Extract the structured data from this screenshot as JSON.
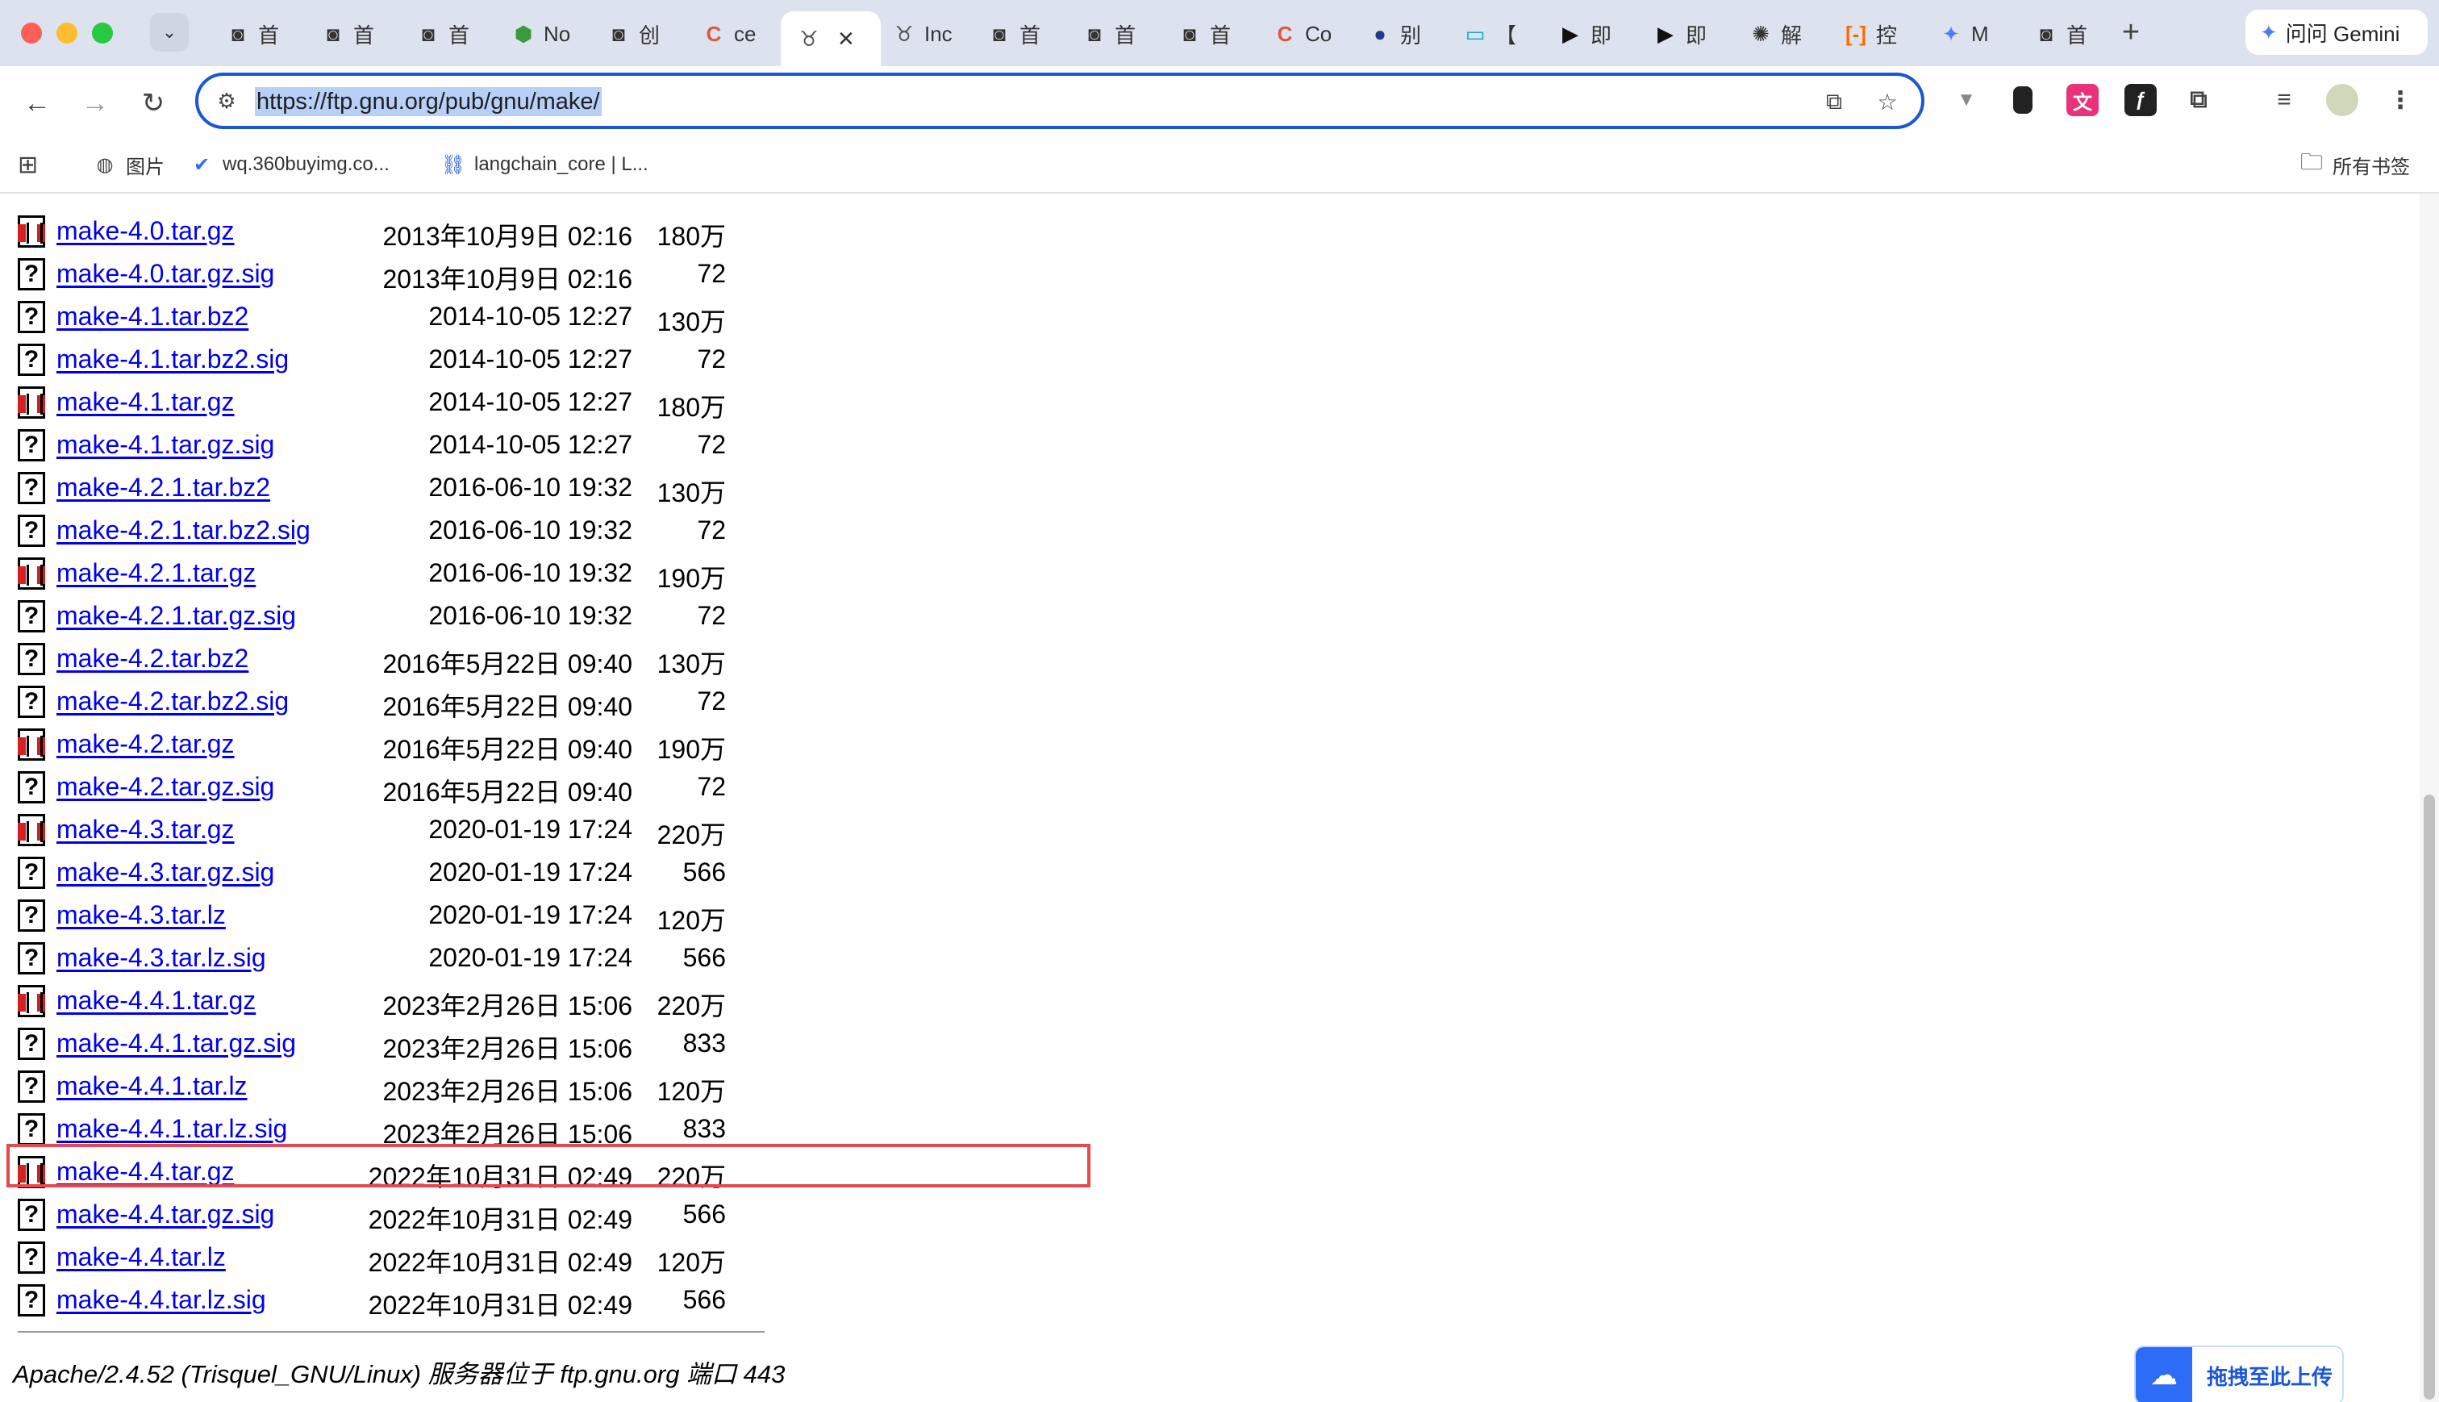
{
  "browser": {
    "tabs": [
      {
        "icon": "robot-icon",
        "label": "首",
        "color": "#333333"
      },
      {
        "icon": "robot-icon",
        "label": "首",
        "color": "#333333"
      },
      {
        "icon": "robot-icon",
        "label": "首",
        "color": "#333333"
      },
      {
        "icon": "hexagon-icon",
        "label": "No",
        "color": "#3a9a3a"
      },
      {
        "icon": "robot-icon",
        "label": "创",
        "color": "#333333"
      },
      {
        "icon": "c-logo-icon",
        "label": "ce",
        "color": "#e4553a"
      },
      {
        "icon": "gnu-icon",
        "label": "",
        "color": "#555555",
        "active": true
      },
      {
        "icon": "gnu-icon",
        "label": "Inc",
        "color": "#555555"
      },
      {
        "icon": "robot-icon",
        "label": "首",
        "color": "#333333"
      },
      {
        "icon": "robot-icon",
        "label": "首",
        "color": "#333333"
      },
      {
        "icon": "robot-icon",
        "label": "首",
        "color": "#333333"
      },
      {
        "icon": "c-logo-icon",
        "label": "Co",
        "color": "#e4553a"
      },
      {
        "icon": "openeuler-icon",
        "label": "别",
        "color": "#1d3c8f"
      },
      {
        "icon": "bilibili-icon",
        "label": "【",
        "color": "#00a1d6"
      },
      {
        "icon": "arrow-app-icon",
        "label": "即",
        "color": "#111111"
      },
      {
        "icon": "arrow-app-icon",
        "label": "即",
        "color": "#111111"
      },
      {
        "icon": "openai-icon",
        "label": "解",
        "color": "#333333"
      },
      {
        "icon": "bracket-icon",
        "label": "控",
        "color": "#ff6a00"
      },
      {
        "icon": "gemini-star-icon",
        "label": "M",
        "color": "#4f7cf7"
      },
      {
        "icon": "robot-icon",
        "label": "首",
        "color": "#333333"
      }
    ],
    "gemini_label": "问问 Gemini",
    "url": "https://ftp.gnu.org/pub/gnu/make/",
    "bookmarks": [
      {
        "icon": "image-icon",
        "label": "图片"
      },
      {
        "icon": "check-logo-icon",
        "label": "wq.360buyimg.co..."
      },
      {
        "icon": "langchain-icon",
        "label": "langchain_core | L..."
      }
    ],
    "all_bookmarks_label": "所有书签"
  },
  "listing": {
    "rows": [
      {
        "type": "gz",
        "name": "make-4.0.tar.gz",
        "date": "2013年10月9日 02:16",
        "size": "180万"
      },
      {
        "type": "unknown",
        "name": "make-4.0.tar.gz.sig",
        "date": "2013年10月9日 02:16",
        "size": "72"
      },
      {
        "type": "unknown",
        "name": "make-4.1.tar.bz2",
        "date": "2014-10-05 12:27",
        "size": "130万"
      },
      {
        "type": "unknown",
        "name": "make-4.1.tar.bz2.sig",
        "date": "2014-10-05 12:27",
        "size": "72"
      },
      {
        "type": "gz",
        "name": "make-4.1.tar.gz",
        "date": "2014-10-05 12:27",
        "size": "180万"
      },
      {
        "type": "unknown",
        "name": "make-4.1.tar.gz.sig",
        "date": "2014-10-05 12:27",
        "size": "72"
      },
      {
        "type": "unknown",
        "name": "make-4.2.1.tar.bz2",
        "date": "2016-06-10 19:32",
        "size": "130万"
      },
      {
        "type": "unknown",
        "name": "make-4.2.1.tar.bz2.sig",
        "date": "2016-06-10 19:32",
        "size": "72"
      },
      {
        "type": "gz",
        "name": "make-4.2.1.tar.gz",
        "date": "2016-06-10 19:32",
        "size": "190万"
      },
      {
        "type": "unknown",
        "name": "make-4.2.1.tar.gz.sig",
        "date": "2016-06-10 19:32",
        "size": "72"
      },
      {
        "type": "unknown",
        "name": "make-4.2.tar.bz2",
        "date": "2016年5月22日 09:40",
        "size": "130万"
      },
      {
        "type": "unknown",
        "name": "make-4.2.tar.bz2.sig",
        "date": "2016年5月22日 09:40",
        "size": "72"
      },
      {
        "type": "gz",
        "name": "make-4.2.tar.gz",
        "date": "2016年5月22日 09:40",
        "size": "190万"
      },
      {
        "type": "unknown",
        "name": "make-4.2.tar.gz.sig",
        "date": "2016年5月22日 09:40",
        "size": "72"
      },
      {
        "type": "gz",
        "name": "make-4.3.tar.gz",
        "date": "2020-01-19 17:24",
        "size": "220万"
      },
      {
        "type": "unknown",
        "name": "make-4.3.tar.gz.sig",
        "date": "2020-01-19 17:24",
        "size": "566"
      },
      {
        "type": "unknown",
        "name": "make-4.3.tar.lz",
        "date": "2020-01-19 17:24",
        "size": "120万"
      },
      {
        "type": "unknown",
        "name": "make-4.3.tar.lz.sig",
        "date": "2020-01-19 17:24",
        "size": "566"
      },
      {
        "type": "gz",
        "name": "make-4.4.1.tar.gz",
        "date": "2023年2月26日 15:06",
        "size": "220万"
      },
      {
        "type": "unknown",
        "name": "make-4.4.1.tar.gz.sig",
        "date": "2023年2月26日 15:06",
        "size": "833"
      },
      {
        "type": "unknown",
        "name": "make-4.4.1.tar.lz",
        "date": "2023年2月26日 15:06",
        "size": "120万"
      },
      {
        "type": "unknown",
        "name": "make-4.4.1.tar.lz.sig",
        "date": "2023年2月26日 15:06",
        "size": "833"
      },
      {
        "type": "gz",
        "name": "make-4.4.tar.gz",
        "date": "2022年10月31日 02:49",
        "size": "220万",
        "highlighted": true
      },
      {
        "type": "unknown",
        "name": "make-4.4.tar.gz.sig",
        "date": "2022年10月31日 02:49",
        "size": "566"
      },
      {
        "type": "unknown",
        "name": "make-4.4.tar.lz",
        "date": "2022年10月31日 02:49",
        "size": "120万"
      },
      {
        "type": "unknown",
        "name": "make-4.4.tar.lz.sig",
        "date": "2022年10月31日 02:49",
        "size": "566"
      }
    ],
    "server_signature": "Apache/2.4.52 (Trisquel_GNU/Linux) 服务器位于 ftp.gnu.org 端口 443"
  },
  "upload_widget": {
    "icon": "baidu-cloud-icon",
    "label": "拖拽至此上传"
  },
  "highlight_color": "#e5484d",
  "link_color": "#0000ee"
}
